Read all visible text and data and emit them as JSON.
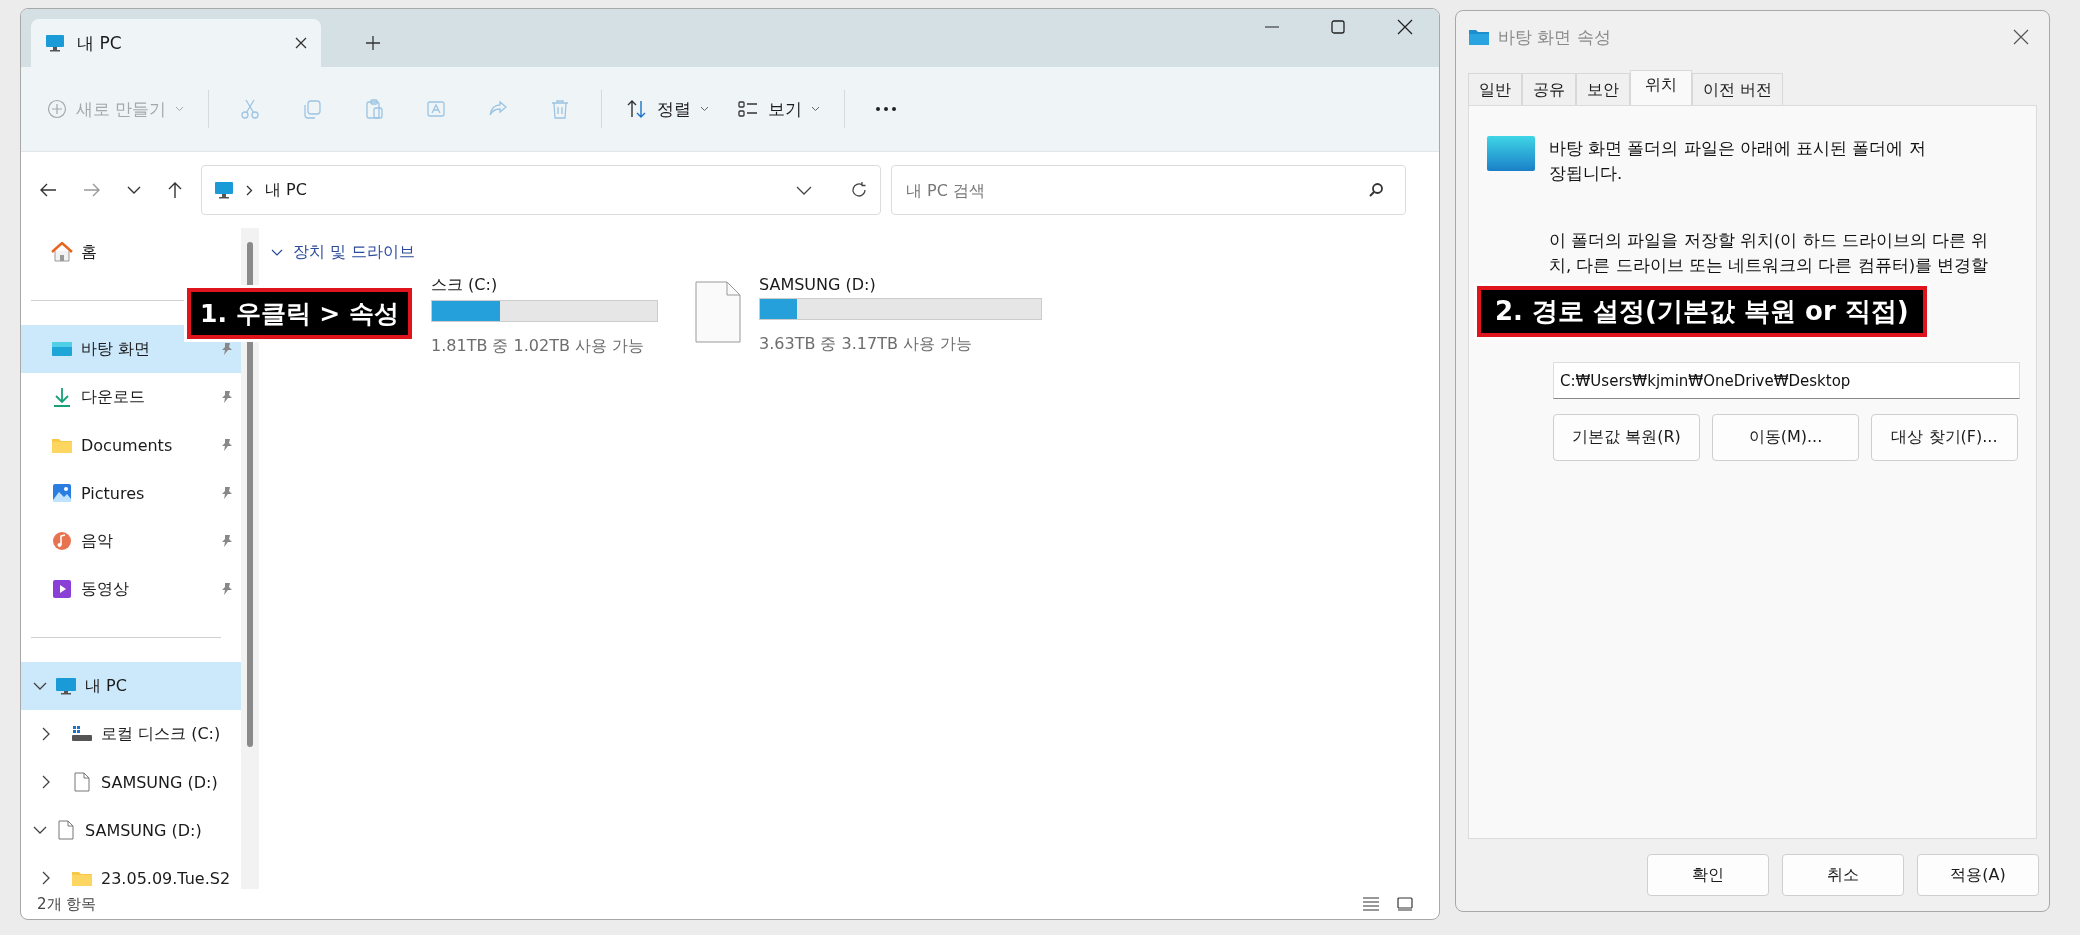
{
  "explorer": {
    "tab": {
      "title": "내 PC"
    },
    "toolbar": [
      {
        "kind": "new",
        "label": "새로 만들기",
        "disabled": true
      },
      {
        "kind": "cut",
        "disabled": true
      },
      {
        "kind": "copy",
        "disabled": true
      },
      {
        "kind": "paste",
        "disabled": true
      },
      {
        "kind": "rename",
        "disabled": true
      },
      {
        "kind": "share",
        "disabled": true
      },
      {
        "kind": "delete",
        "disabled": true
      },
      {
        "kind": "sort",
        "label": "정렬",
        "disabled": false
      },
      {
        "kind": "view",
        "label": "보기",
        "disabled": false
      },
      {
        "kind": "more"
      }
    ],
    "nav": {
      "forward_disabled": true
    },
    "address": {
      "location": "내 PC",
      "search_placeholder": "내 PC 검색"
    },
    "sidebar": {
      "home": {
        "label": "홈",
        "kind": "home",
        "selected": false
      },
      "pinned": [
        {
          "label": "바탕 화면",
          "kind": "desktop",
          "selected": true
        },
        {
          "label": "다운로드",
          "kind": "download",
          "selected": false
        },
        {
          "label": "Documents",
          "kind": "folder",
          "selected": false
        },
        {
          "label": "Pictures",
          "kind": "pictures",
          "selected": false
        },
        {
          "label": "음악",
          "kind": "music",
          "selected": false
        },
        {
          "label": "동영상",
          "kind": "video",
          "selected": false
        }
      ],
      "tree": [
        {
          "label": "내 PC",
          "kind": "pc",
          "expanded": true,
          "selected": true,
          "children": [
            {
              "label": "로컬 디스크 (C:)",
              "kind": "drive",
              "expanded": false,
              "selected": false
            },
            {
              "label": "SAMSUNG (D:)",
              "kind": "file",
              "expanded": false,
              "selected": false
            }
          ]
        },
        {
          "label": "SAMSUNG (D:)",
          "kind": "file",
          "expanded": true,
          "selected": false,
          "children": [
            {
              "label": "23.05.09.Tue.S2",
              "kind": "folder",
              "expanded": false,
              "selected": false
            }
          ]
        }
      ]
    },
    "section": {
      "title": "장치 및 드라이브",
      "expanded": true
    },
    "drives": [
      {
        "name": "스크 (C:)",
        "level": 0.3,
        "capacity": "1.81TB 중 1.02TB 사용 가능"
      },
      {
        "name": "SAMSUNG (D:)",
        "kind": "file",
        "level": 0.13,
        "capacity": "3.63TB 중 3.17TB 사용 가능"
      }
    ],
    "status": "2개 항목",
    "callout": "1. 우클릭 > 속성"
  },
  "dialog": {
    "title": "바탕 화면 속성",
    "tabs": [
      {
        "label": "일반",
        "selected": false
      },
      {
        "label": "공유",
        "selected": false
      },
      {
        "label": "보안",
        "selected": false
      },
      {
        "label": "위치",
        "selected": true
      },
      {
        "label": "이전 버전",
        "selected": false
      }
    ],
    "description": [
      "바탕 화면 폴더의 파일은 아래에 표시된 폴더에 저",
      "장됩니다."
    ],
    "instruction": [
      "이 폴더의 파일을 저장할 위치(이 하드 드라이브의 다른 위",
      "치, 다른 드라이브 또는 네트워크의 다른 컴퓨터)를 변경할"
    ],
    "callout": "2. 경로 설정(기본값 복원 or 직접)",
    "path": "C:₩Users₩kjmin₩OneDrive₩Desktop",
    "actions": [
      "기본값 복원(R)",
      "이동(M)...",
      "대상 찾기(F)..."
    ],
    "buttons": [
      "확인",
      "취소",
      "적용(A)"
    ]
  }
}
